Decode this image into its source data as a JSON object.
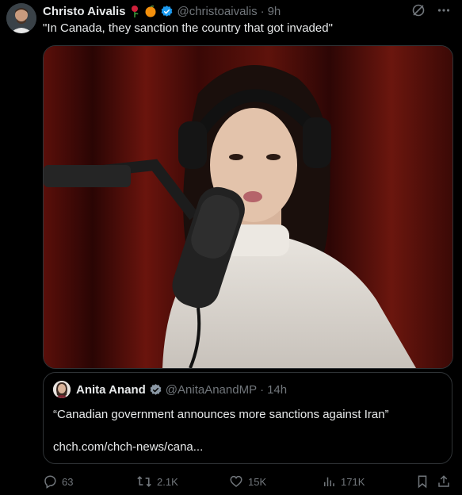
{
  "tweet": {
    "author_name": "Christo Aivalis",
    "author_handle": "@christoaivalis",
    "separator": "·",
    "time": "9h",
    "text": "\"In Canada, they sanction the country that got invaded\"",
    "emoji_badges": [
      "rose-emoji",
      "orange-emoji"
    ],
    "verified_color": "#1d9bf0"
  },
  "quote": {
    "author_name": "Anita Anand",
    "author_handle": "@AnitaAnandMP",
    "separator": "·",
    "time": "14h",
    "text": "“Canadian government announces more sanctions against Iran”",
    "link": "chch.com/chch-news/cana..."
  },
  "actions": {
    "replies": "63",
    "reposts": "2.1K",
    "likes": "15K",
    "views": "171K"
  },
  "colors": {
    "background": "#000000",
    "text_primary": "#e7e9ea",
    "text_secondary": "#71767b",
    "border": "#2f3336"
  }
}
